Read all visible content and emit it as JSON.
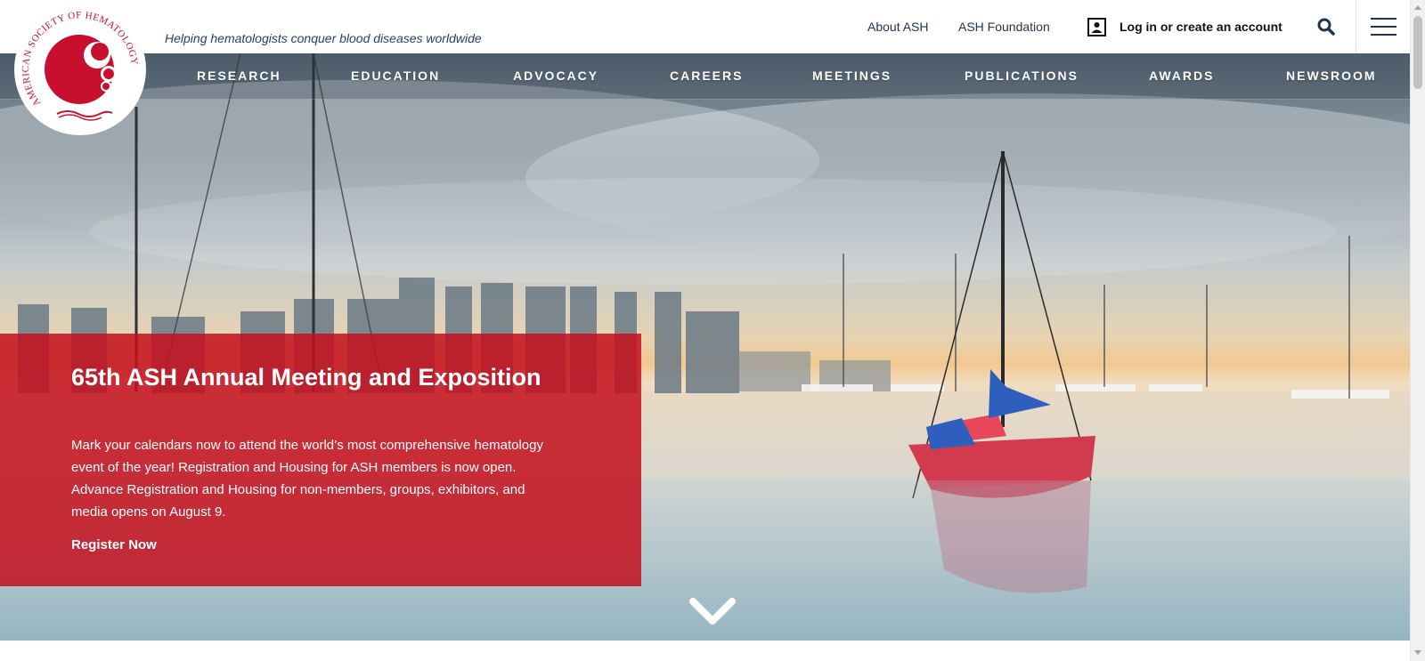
{
  "header": {
    "tagline": "Helping hematologists conquer blood diseases worldwide",
    "about_label": "About ASH",
    "foundation_label": "ASH Foundation",
    "login_label": "Log in or create an account"
  },
  "logo": {
    "text": "AMERICAN SOCIETY OF HEMATOLOGY",
    "brand_color": "#c8102e"
  },
  "nav": {
    "items": [
      {
        "label": "RESEARCH"
      },
      {
        "label": "EDUCATION"
      },
      {
        "label": "ADVOCACY"
      },
      {
        "label": "CAREERS"
      },
      {
        "label": "MEETINGS"
      },
      {
        "label": "PUBLICATIONS"
      },
      {
        "label": "AWARDS"
      },
      {
        "label": "NEWSROOM"
      }
    ]
  },
  "hero": {
    "title": "65th ASH Annual Meeting and Exposition",
    "body": "Mark your calendars now to attend the world’s most comprehensive hematology event of the year! Registration and Housing for ASH members is now open. Advance Registration and Housing for non-members, groups, exhibitors, and media opens on August 9.",
    "cta_label": "Register Now",
    "panel_color": "#c4101e"
  },
  "icons": {
    "login": "user-badge-icon",
    "search": "search-icon",
    "menu": "hamburger-menu-icon",
    "scroll": "chevron-down-icon"
  }
}
